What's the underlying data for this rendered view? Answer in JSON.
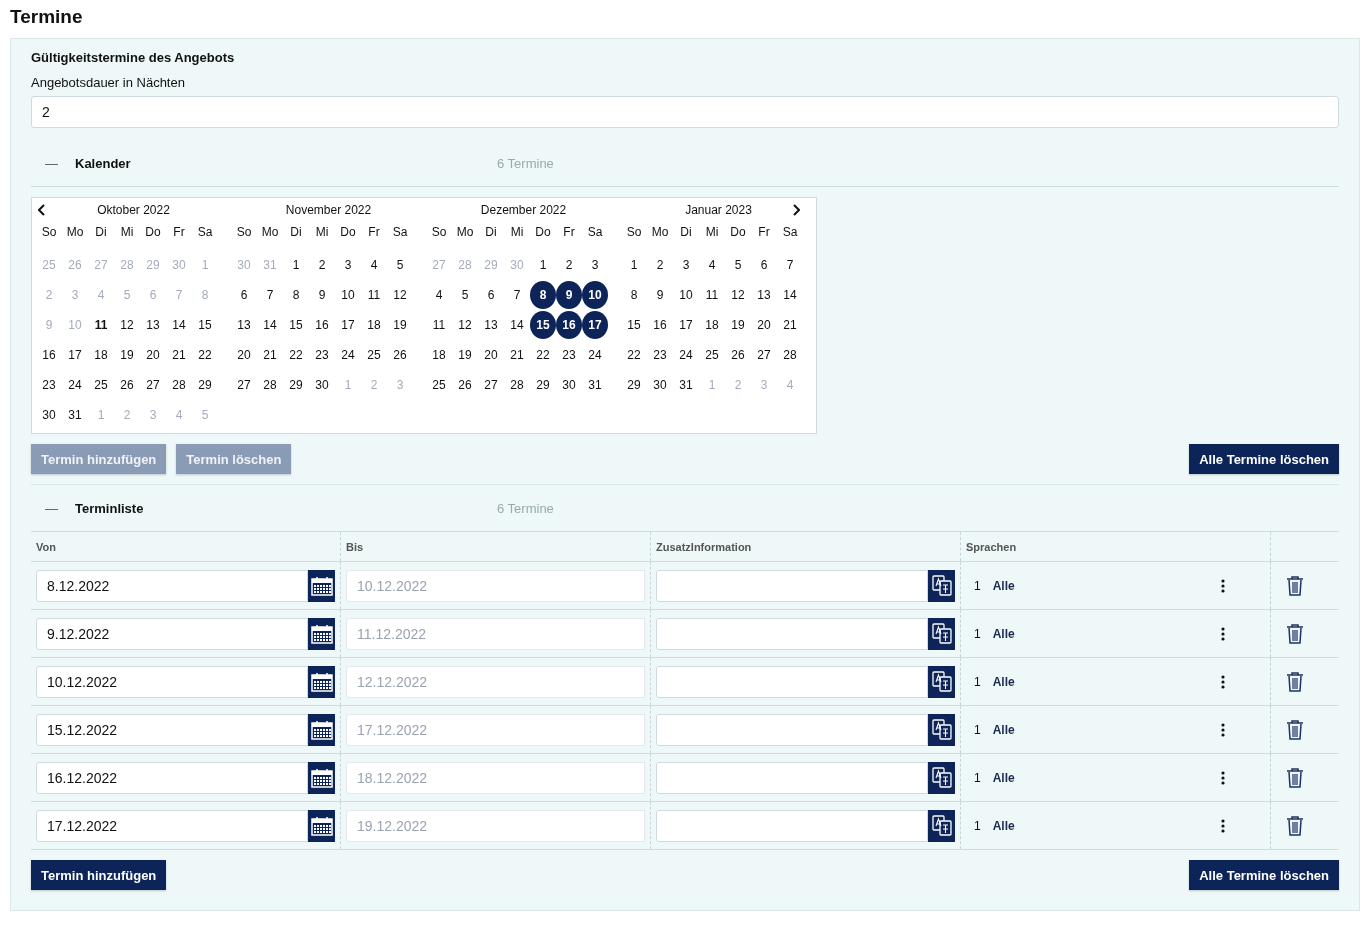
{
  "page_title": "Termine",
  "validity": {
    "heading": "Gültigkeitstermine des Angebots",
    "duration_label": "Angebotsdauer in Nächten",
    "duration_value": "2"
  },
  "calendar_section": {
    "expanded": true,
    "toggle": "—",
    "title": "Kalender",
    "count": "6 Termine"
  },
  "calendar": {
    "months": [
      {
        "title": "Oktober 2022",
        "weekdays": [
          "So",
          "Mo",
          "Di",
          "Mi",
          "Do",
          "Fr",
          "Sa"
        ],
        "weeks": [
          [
            {
              "day": "25",
              "disabled": true,
              "selected": false,
              "today": false
            },
            {
              "day": "26",
              "disabled": true,
              "selected": false,
              "today": false
            },
            {
              "day": "27",
              "disabled": true,
              "selected": false,
              "today": false
            },
            {
              "day": "28",
              "disabled": true,
              "selected": false,
              "today": false
            },
            {
              "day": "29",
              "disabled": true,
              "selected": false,
              "today": false
            },
            {
              "day": "30",
              "disabled": true,
              "selected": false,
              "today": false
            },
            {
              "day": "1",
              "disabled": true,
              "selected": false,
              "today": false
            }
          ],
          [
            {
              "day": "2",
              "disabled": true,
              "selected": false,
              "today": false
            },
            {
              "day": "3",
              "disabled": true,
              "selected": false,
              "today": false
            },
            {
              "day": "4",
              "disabled": true,
              "selected": false,
              "today": false
            },
            {
              "day": "5",
              "disabled": true,
              "selected": false,
              "today": false
            },
            {
              "day": "6",
              "disabled": true,
              "selected": false,
              "today": false
            },
            {
              "day": "7",
              "disabled": true,
              "selected": false,
              "today": false
            },
            {
              "day": "8",
              "disabled": true,
              "selected": false,
              "today": false
            }
          ],
          [
            {
              "day": "9",
              "disabled": true,
              "selected": false,
              "today": false
            },
            {
              "day": "10",
              "disabled": true,
              "selected": false,
              "today": false
            },
            {
              "day": "11",
              "disabled": false,
              "selected": false,
              "today": true
            },
            {
              "day": "12",
              "disabled": false,
              "selected": false,
              "today": false
            },
            {
              "day": "13",
              "disabled": false,
              "selected": false,
              "today": false
            },
            {
              "day": "14",
              "disabled": false,
              "selected": false,
              "today": false
            },
            {
              "day": "15",
              "disabled": false,
              "selected": false,
              "today": false
            }
          ],
          [
            {
              "day": "16",
              "disabled": false,
              "selected": false,
              "today": false
            },
            {
              "day": "17",
              "disabled": false,
              "selected": false,
              "today": false
            },
            {
              "day": "18",
              "disabled": false,
              "selected": false,
              "today": false
            },
            {
              "day": "19",
              "disabled": false,
              "selected": false,
              "today": false
            },
            {
              "day": "20",
              "disabled": false,
              "selected": false,
              "today": false
            },
            {
              "day": "21",
              "disabled": false,
              "selected": false,
              "today": false
            },
            {
              "day": "22",
              "disabled": false,
              "selected": false,
              "today": false
            }
          ],
          [
            {
              "day": "23",
              "disabled": false,
              "selected": false,
              "today": false
            },
            {
              "day": "24",
              "disabled": false,
              "selected": false,
              "today": false
            },
            {
              "day": "25",
              "disabled": false,
              "selected": false,
              "today": false
            },
            {
              "day": "26",
              "disabled": false,
              "selected": false,
              "today": false
            },
            {
              "day": "27",
              "disabled": false,
              "selected": false,
              "today": false
            },
            {
              "day": "28",
              "disabled": false,
              "selected": false,
              "today": false
            },
            {
              "day": "29",
              "disabled": false,
              "selected": false,
              "today": false
            }
          ],
          [
            {
              "day": "30",
              "disabled": false,
              "selected": false,
              "today": false
            },
            {
              "day": "31",
              "disabled": false,
              "selected": false,
              "today": false
            },
            {
              "day": "1",
              "disabled": true,
              "selected": false,
              "today": false
            },
            {
              "day": "2",
              "disabled": true,
              "selected": false,
              "today": false
            },
            {
              "day": "3",
              "disabled": true,
              "selected": false,
              "today": false
            },
            {
              "day": "4",
              "disabled": true,
              "selected": false,
              "today": false
            },
            {
              "day": "5",
              "disabled": true,
              "selected": false,
              "today": false
            }
          ]
        ]
      },
      {
        "title": "November 2022",
        "weekdays": [
          "So",
          "Mo",
          "Di",
          "Mi",
          "Do",
          "Fr",
          "Sa"
        ],
        "weeks": [
          [
            {
              "day": "30",
              "disabled": true,
              "selected": false,
              "today": false
            },
            {
              "day": "31",
              "disabled": true,
              "selected": false,
              "today": false
            },
            {
              "day": "1",
              "disabled": false,
              "selected": false,
              "today": false
            },
            {
              "day": "2",
              "disabled": false,
              "selected": false,
              "today": false
            },
            {
              "day": "3",
              "disabled": false,
              "selected": false,
              "today": false
            },
            {
              "day": "4",
              "disabled": false,
              "selected": false,
              "today": false
            },
            {
              "day": "5",
              "disabled": false,
              "selected": false,
              "today": false
            }
          ],
          [
            {
              "day": "6",
              "disabled": false,
              "selected": false,
              "today": false
            },
            {
              "day": "7",
              "disabled": false,
              "selected": false,
              "today": false
            },
            {
              "day": "8",
              "disabled": false,
              "selected": false,
              "today": false
            },
            {
              "day": "9",
              "disabled": false,
              "selected": false,
              "today": false
            },
            {
              "day": "10",
              "disabled": false,
              "selected": false,
              "today": false
            },
            {
              "day": "11",
              "disabled": false,
              "selected": false,
              "today": false
            },
            {
              "day": "12",
              "disabled": false,
              "selected": false,
              "today": false
            }
          ],
          [
            {
              "day": "13",
              "disabled": false,
              "selected": false,
              "today": false
            },
            {
              "day": "14",
              "disabled": false,
              "selected": false,
              "today": false
            },
            {
              "day": "15",
              "disabled": false,
              "selected": false,
              "today": false
            },
            {
              "day": "16",
              "disabled": false,
              "selected": false,
              "today": false
            },
            {
              "day": "17",
              "disabled": false,
              "selected": false,
              "today": false
            },
            {
              "day": "18",
              "disabled": false,
              "selected": false,
              "today": false
            },
            {
              "day": "19",
              "disabled": false,
              "selected": false,
              "today": false
            }
          ],
          [
            {
              "day": "20",
              "disabled": false,
              "selected": false,
              "today": false
            },
            {
              "day": "21",
              "disabled": false,
              "selected": false,
              "today": false
            },
            {
              "day": "22",
              "disabled": false,
              "selected": false,
              "today": false
            },
            {
              "day": "23",
              "disabled": false,
              "selected": false,
              "today": false
            },
            {
              "day": "24",
              "disabled": false,
              "selected": false,
              "today": false
            },
            {
              "day": "25",
              "disabled": false,
              "selected": false,
              "today": false
            },
            {
              "day": "26",
              "disabled": false,
              "selected": false,
              "today": false
            }
          ],
          [
            {
              "day": "27",
              "disabled": false,
              "selected": false,
              "today": false
            },
            {
              "day": "28",
              "disabled": false,
              "selected": false,
              "today": false
            },
            {
              "day": "29",
              "disabled": false,
              "selected": false,
              "today": false
            },
            {
              "day": "30",
              "disabled": false,
              "selected": false,
              "today": false
            },
            {
              "day": "1",
              "disabled": true,
              "selected": false,
              "today": false
            },
            {
              "day": "2",
              "disabled": true,
              "selected": false,
              "today": false
            },
            {
              "day": "3",
              "disabled": true,
              "selected": false,
              "today": false
            }
          ]
        ]
      },
      {
        "title": "Dezember 2022",
        "weekdays": [
          "So",
          "Mo",
          "Di",
          "Mi",
          "Do",
          "Fr",
          "Sa"
        ],
        "weeks": [
          [
            {
              "day": "27",
              "disabled": true,
              "selected": false,
              "today": false
            },
            {
              "day": "28",
              "disabled": true,
              "selected": false,
              "today": false
            },
            {
              "day": "29",
              "disabled": true,
              "selected": false,
              "today": false
            },
            {
              "day": "30",
              "disabled": true,
              "selected": false,
              "today": false
            },
            {
              "day": "1",
              "disabled": false,
              "selected": false,
              "today": false
            },
            {
              "day": "2",
              "disabled": false,
              "selected": false,
              "today": false
            },
            {
              "day": "3",
              "disabled": false,
              "selected": false,
              "today": false
            }
          ],
          [
            {
              "day": "4",
              "disabled": false,
              "selected": false,
              "today": false
            },
            {
              "day": "5",
              "disabled": false,
              "selected": false,
              "today": false
            },
            {
              "day": "6",
              "disabled": false,
              "selected": false,
              "today": false
            },
            {
              "day": "7",
              "disabled": false,
              "selected": false,
              "today": false
            },
            {
              "day": "8",
              "disabled": false,
              "selected": true,
              "today": false
            },
            {
              "day": "9",
              "disabled": false,
              "selected": true,
              "today": false
            },
            {
              "day": "10",
              "disabled": false,
              "selected": true,
              "today": false
            }
          ],
          [
            {
              "day": "11",
              "disabled": false,
              "selected": false,
              "today": false
            },
            {
              "day": "12",
              "disabled": false,
              "selected": false,
              "today": false
            },
            {
              "day": "13",
              "disabled": false,
              "selected": false,
              "today": false
            },
            {
              "day": "14",
              "disabled": false,
              "selected": false,
              "today": false
            },
            {
              "day": "15",
              "disabled": false,
              "selected": true,
              "today": false
            },
            {
              "day": "16",
              "disabled": false,
              "selected": true,
              "today": false
            },
            {
              "day": "17",
              "disabled": false,
              "selected": true,
              "today": false
            }
          ],
          [
            {
              "day": "18",
              "disabled": false,
              "selected": false,
              "today": false
            },
            {
              "day": "19",
              "disabled": false,
              "selected": false,
              "today": false
            },
            {
              "day": "20",
              "disabled": false,
              "selected": false,
              "today": false
            },
            {
              "day": "21",
              "disabled": false,
              "selected": false,
              "today": false
            },
            {
              "day": "22",
              "disabled": false,
              "selected": false,
              "today": false
            },
            {
              "day": "23",
              "disabled": false,
              "selected": false,
              "today": false
            },
            {
              "day": "24",
              "disabled": false,
              "selected": false,
              "today": false
            }
          ],
          [
            {
              "day": "25",
              "disabled": false,
              "selected": false,
              "today": false
            },
            {
              "day": "26",
              "disabled": false,
              "selected": false,
              "today": false
            },
            {
              "day": "27",
              "disabled": false,
              "selected": false,
              "today": false
            },
            {
              "day": "28",
              "disabled": false,
              "selected": false,
              "today": false
            },
            {
              "day": "29",
              "disabled": false,
              "selected": false,
              "today": false
            },
            {
              "day": "30",
              "disabled": false,
              "selected": false,
              "today": false
            },
            {
              "day": "31",
              "disabled": false,
              "selected": false,
              "today": false
            }
          ]
        ]
      },
      {
        "title": "Januar 2023",
        "weekdays": [
          "So",
          "Mo",
          "Di",
          "Mi",
          "Do",
          "Fr",
          "Sa"
        ],
        "weeks": [
          [
            {
              "day": "1",
              "disabled": false,
              "selected": false,
              "today": false
            },
            {
              "day": "2",
              "disabled": false,
              "selected": false,
              "today": false
            },
            {
              "day": "3",
              "disabled": false,
              "selected": false,
              "today": false
            },
            {
              "day": "4",
              "disabled": false,
              "selected": false,
              "today": false
            },
            {
              "day": "5",
              "disabled": false,
              "selected": false,
              "today": false
            },
            {
              "day": "6",
              "disabled": false,
              "selected": false,
              "today": false
            },
            {
              "day": "7",
              "disabled": false,
              "selected": false,
              "today": false
            }
          ],
          [
            {
              "day": "8",
              "disabled": false,
              "selected": false,
              "today": false
            },
            {
              "day": "9",
              "disabled": false,
              "selected": false,
              "today": false
            },
            {
              "day": "10",
              "disabled": false,
              "selected": false,
              "today": false
            },
            {
              "day": "11",
              "disabled": false,
              "selected": false,
              "today": false
            },
            {
              "day": "12",
              "disabled": false,
              "selected": false,
              "today": false
            },
            {
              "day": "13",
              "disabled": false,
              "selected": false,
              "today": false
            },
            {
              "day": "14",
              "disabled": false,
              "selected": false,
              "today": false
            }
          ],
          [
            {
              "day": "15",
              "disabled": false,
              "selected": false,
              "today": false
            },
            {
              "day": "16",
              "disabled": false,
              "selected": false,
              "today": false
            },
            {
              "day": "17",
              "disabled": false,
              "selected": false,
              "today": false
            },
            {
              "day": "18",
              "disabled": false,
              "selected": false,
              "today": false
            },
            {
              "day": "19",
              "disabled": false,
              "selected": false,
              "today": false
            },
            {
              "day": "20",
              "disabled": false,
              "selected": false,
              "today": false
            },
            {
              "day": "21",
              "disabled": false,
              "selected": false,
              "today": false
            }
          ],
          [
            {
              "day": "22",
              "disabled": false,
              "selected": false,
              "today": false
            },
            {
              "day": "23",
              "disabled": false,
              "selected": false,
              "today": false
            },
            {
              "day": "24",
              "disabled": false,
              "selected": false,
              "today": false
            },
            {
              "day": "25",
              "disabled": false,
              "selected": false,
              "today": false
            },
            {
              "day": "26",
              "disabled": false,
              "selected": false,
              "today": false
            },
            {
              "day": "27",
              "disabled": false,
              "selected": false,
              "today": false
            },
            {
              "day": "28",
              "disabled": false,
              "selected": false,
              "today": false
            }
          ],
          [
            {
              "day": "29",
              "disabled": false,
              "selected": false,
              "today": false
            },
            {
              "day": "30",
              "disabled": false,
              "selected": false,
              "today": false
            },
            {
              "day": "31",
              "disabled": false,
              "selected": false,
              "today": false
            },
            {
              "day": "1",
              "disabled": true,
              "selected": false,
              "today": false
            },
            {
              "day": "2",
              "disabled": true,
              "selected": false,
              "today": false
            },
            {
              "day": "3",
              "disabled": true,
              "selected": false,
              "today": false
            },
            {
              "day": "4",
              "disabled": true,
              "selected": false,
              "today": false
            }
          ]
        ]
      }
    ]
  },
  "calendar_buttons": {
    "left": [
      {
        "label": "Termin hinzufügen",
        "disabled": true
      },
      {
        "label": "Termin löschen",
        "disabled": true
      }
    ],
    "right": [
      {
        "label": "Alle Termine löschen",
        "disabled": false
      }
    ]
  },
  "list_section": {
    "expanded": true,
    "toggle": "—",
    "title": "Terminliste",
    "count": "6 Termine"
  },
  "table": {
    "columns": [
      "Von",
      "Bis",
      "ZusatzInformation",
      "Sprachen"
    ],
    "rows": [
      {
        "von": "8.12.2022",
        "bis": "10.12.2022",
        "language_count": "1",
        "languages": "Alle"
      },
      {
        "von": "9.12.2022",
        "bis": "11.12.2022",
        "language_count": "1",
        "languages": "Alle"
      },
      {
        "von": "10.12.2022",
        "bis": "12.12.2022",
        "language_count": "1",
        "languages": "Alle"
      },
      {
        "von": "15.12.2022",
        "bis": "17.12.2022",
        "language_count": "1",
        "languages": "Alle"
      },
      {
        "von": "16.12.2022",
        "bis": "18.12.2022",
        "language_count": "1",
        "languages": "Alle"
      },
      {
        "von": "17.12.2022",
        "bis": "19.12.2022",
        "language_count": "1",
        "languages": "Alle"
      }
    ]
  },
  "list_buttons": {
    "left": [
      {
        "label": "Termin hinzufügen",
        "disabled": false
      }
    ],
    "right": [
      {
        "label": "Alle Termine löschen",
        "disabled": false
      }
    ]
  }
}
